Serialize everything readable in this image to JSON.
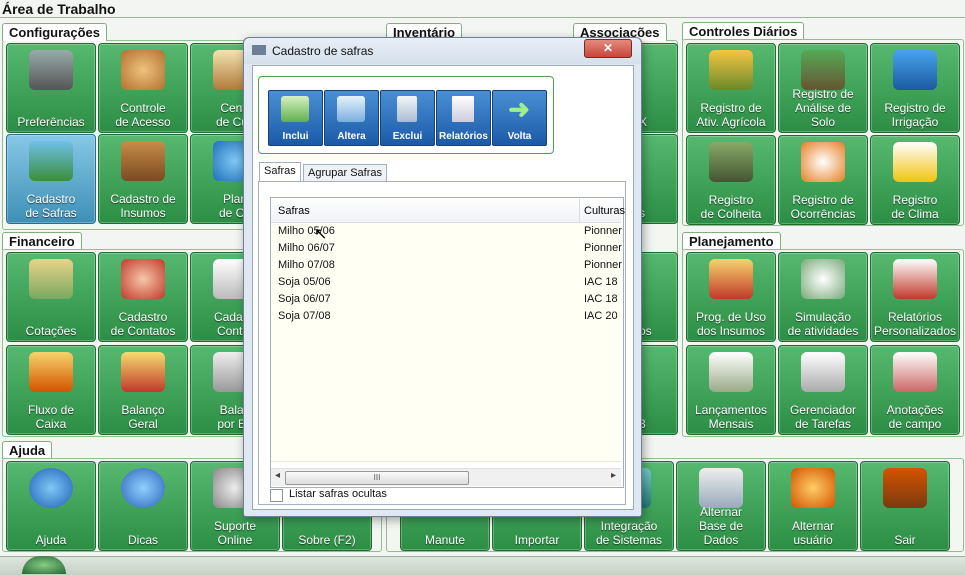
{
  "workspace_title": "Área de Trabalho",
  "sections": {
    "configuracoes": "Configurações",
    "inventario": "Inventário",
    "associacoes": "Associações",
    "controles_diarios": "Controles Diários",
    "financeiro": "Financeiro",
    "planejamento": "Planejamento",
    "ajuda": "Ajuda"
  },
  "tiles": {
    "preferencias": "Preferências",
    "controle_acesso": "Controle\nde Acesso",
    "centro_custo": "Centr\nde Cus",
    "cadastro_safras": "Cadastro\nde Safras",
    "cadastro_insumos": "Cadastro de\nInsumos",
    "plano_contas": "Plan\nde Co",
    "cotacoes": "Cotações",
    "cadastro_contatos": "Cadastro\nde Contatos",
    "cadastro_contratos": "Cadastr\nContra",
    "fluxo_caixa": "Fluxo de\nCaixa",
    "balanco_geral": "Balanço\nGeral",
    "balanco_banco": "Balan\npor Ba",
    "registro_ativ": "Registro de\nAtiv. Agrícola",
    "registro_solo": "Registro de\nAnálise de\nSolo",
    "registro_irrigacao": "Registro de\nIrrigação",
    "registro_colheita": "Registro\nde Colheita",
    "registro_ocorrencias": "Registro de\nOcorrências",
    "registro_clima": "Registro\nde Clima",
    "prog_uso": "Prog. de Uso\ndos Insumos",
    "simulacao": "Simulação\nde atividades",
    "relatorios": "Relatórios\nPersonalizados",
    "lancamentos": "Lançamentos\nMensais",
    "gerenciador": "Gerenciador\nde Tarefas",
    "anotacoes": "Anotações\nde campo",
    "ajuda": "Ajuda",
    "dicas": "Dicas",
    "suporte": "Suporte\nOnline",
    "sobre": "Sobre (F2)",
    "manutencao": "Manute",
    "importar": "Importar",
    "integracao": "Integração\nde Sistemas",
    "alternar_base": "Alternar\nBase de\nDados",
    "alternar_usuario": "Alternar\nusuário",
    "sair": "Sair"
  },
  "hidden_fragments": {
    "x_letter": "X",
    "s1": "s",
    "s2": "s",
    "os": "os",
    "num": "3"
  },
  "dialog": {
    "title": "Cadastro de safras",
    "toolbar": [
      "Inclui",
      "Altera",
      "Exclui",
      "Relatórios",
      "Volta"
    ],
    "tabs": [
      "Safras",
      "Agrupar Safras"
    ],
    "columns": [
      "Safras",
      "Culturas"
    ],
    "rows": [
      {
        "safra": "Milho 05/06",
        "cultura": "Pionner"
      },
      {
        "safra": "Milho 06/07",
        "cultura": "Pionner"
      },
      {
        "safra": "Milho 07/08",
        "cultura": "Pionner"
      },
      {
        "safra": "Soja 05/06",
        "cultura": "IAC 18"
      },
      {
        "safra": "Soja 06/07",
        "cultura": "IAC 18"
      },
      {
        "safra": "Soja 07/08",
        "cultura": "IAC 20"
      }
    ],
    "checkbox_label": "Listar safras ocultas",
    "scroll_grip": "III"
  },
  "colors": {
    "tile_green": "#2c8e45",
    "tile_selected": "#3e8fb6",
    "toolbar_blue": "#1c5aa8",
    "close_red": "#c9453b"
  }
}
